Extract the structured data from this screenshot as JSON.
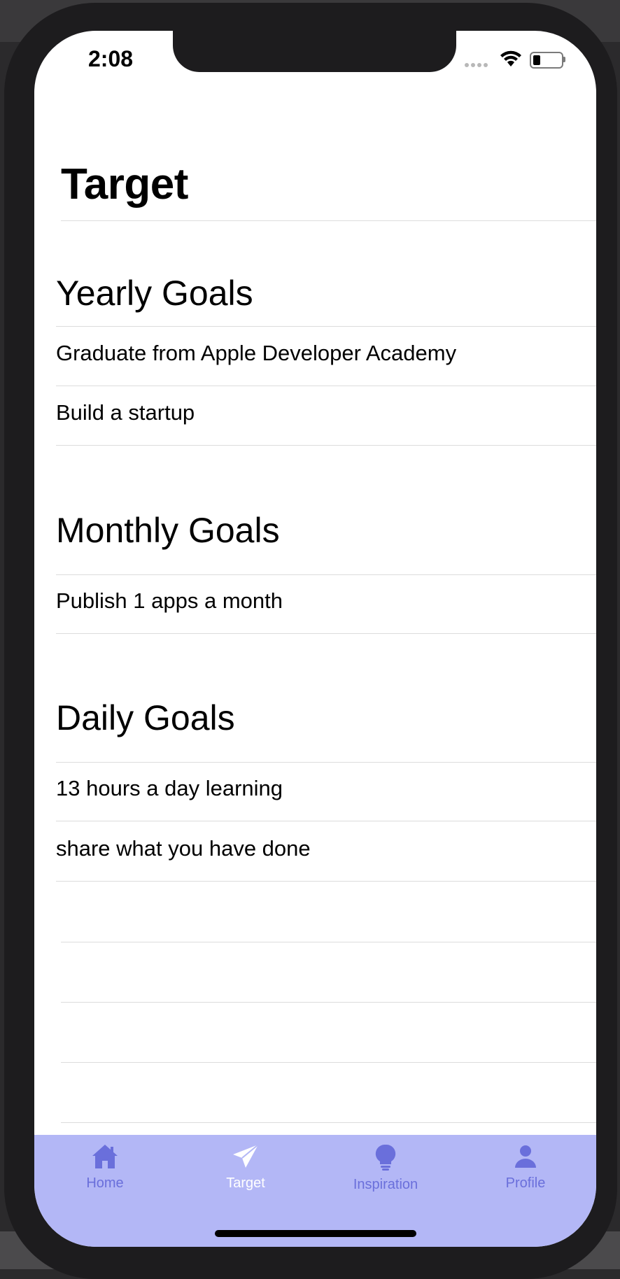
{
  "status_bar": {
    "time": "2:08"
  },
  "page": {
    "title": "Target"
  },
  "sections": [
    {
      "header": "Yearly Goals",
      "items": [
        "Graduate from Apple Developer Academy",
        "Build a startup"
      ]
    },
    {
      "header": "Monthly Goals",
      "items": [
        "Publish 1 apps a month"
      ]
    },
    {
      "header": "Daily Goals",
      "items": [
        "13 hours a day learning",
        "share what you have done"
      ]
    }
  ],
  "tab_bar": {
    "active": "Target",
    "tabs": [
      {
        "label": "Home",
        "icon": "house-icon"
      },
      {
        "label": "Target",
        "icon": "paperplane-icon"
      },
      {
        "label": "Inspiration",
        "icon": "lightbulb-icon"
      },
      {
        "label": "Profile",
        "icon": "person-icon"
      }
    ]
  },
  "colors": {
    "tab_bar_bg": "#b3b7f6",
    "tab_inactive": "#6a6fdb",
    "tab_active": "#ffffff"
  }
}
